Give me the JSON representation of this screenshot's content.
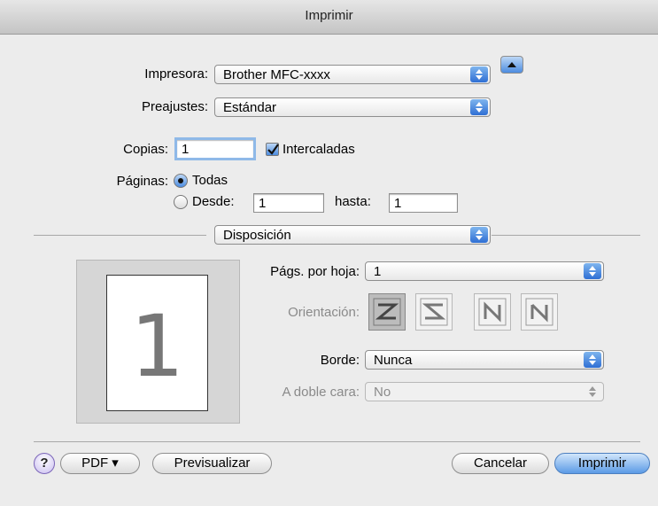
{
  "window": {
    "title": "Imprimir"
  },
  "printer": {
    "label": "Impresora:",
    "value": "Brother MFC-xxxx"
  },
  "presets": {
    "label": "Preajustes:",
    "value": "Estándar"
  },
  "copies": {
    "label": "Copias:",
    "value": "1",
    "collate_label": "Intercaladas",
    "collate_checked": true
  },
  "pages": {
    "label": "Páginas:",
    "all_label": "Todas",
    "from_label": "Desde:",
    "from_value": "1",
    "to_label": "hasta:",
    "to_value": "1",
    "selected": "all"
  },
  "section": {
    "value": "Disposición"
  },
  "layout": {
    "pages_per_sheet_label": "Págs. por hoja:",
    "pages_per_sheet_value": "1",
    "orientation_label": "Orientación:",
    "border_label": "Borde:",
    "border_value": "Nunca",
    "duplex_label": "A doble cara:",
    "duplex_value": "No",
    "preview_number": "1",
    "orientation_icons": [
      "z-order-icon",
      "reverse-z-order-icon",
      "n-order-icon",
      "reverse-n-order-icon"
    ]
  },
  "footer": {
    "help": "?",
    "pdf_label": "PDF ▾",
    "preview_label": "Previsualizar",
    "cancel_label": "Cancelar",
    "print_label": "Imprimir"
  },
  "colors": {
    "accent": "#4c8ce0",
    "default_button": "#5b9ae6",
    "help": "#c9bdf0"
  }
}
